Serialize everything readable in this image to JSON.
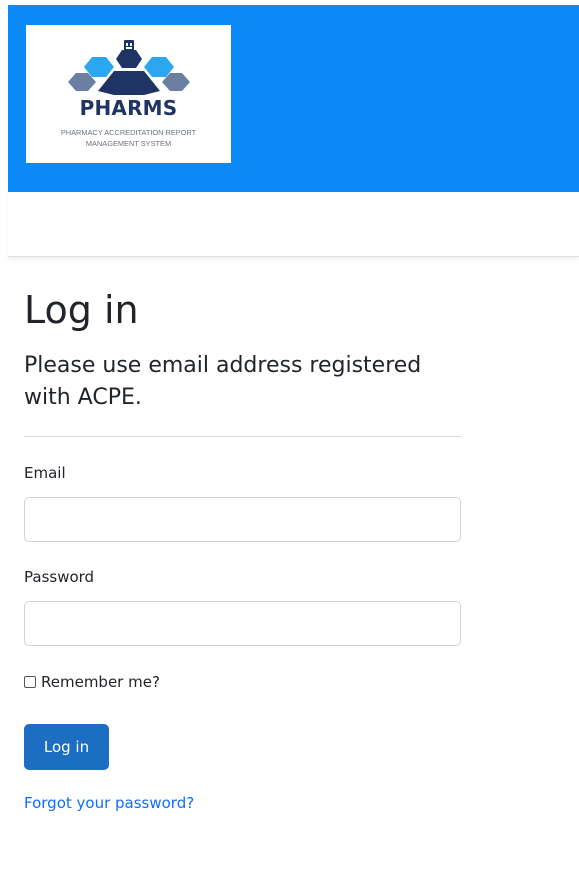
{
  "header": {
    "logo": {
      "title": "PHARMS",
      "subtitle": "PHARMACY ACCREDITATION REPORT\nMANAGEMENT SYSTEM"
    },
    "background_color": "#0b8af7"
  },
  "login": {
    "title": "Log in",
    "subtitle": "Please use email address registered with ACPE.",
    "email": {
      "label": "Email",
      "value": "",
      "placeholder": ""
    },
    "password": {
      "label": "Password",
      "value": "",
      "placeholder": ""
    },
    "remember": {
      "label": "Remember me?",
      "checked": false
    },
    "submit_label": "Log in",
    "forgot_link": "Forgot your password?"
  },
  "colors": {
    "primary_button": "#1b6ec2",
    "link": "#0d6efd",
    "logo_navy": "#1f3464",
    "logo_blue": "#2aa7f0",
    "logo_gray": "#6b7fa1"
  },
  "icons": {
    "logo_mark": "hexagon-cluster-with-building-icon"
  }
}
